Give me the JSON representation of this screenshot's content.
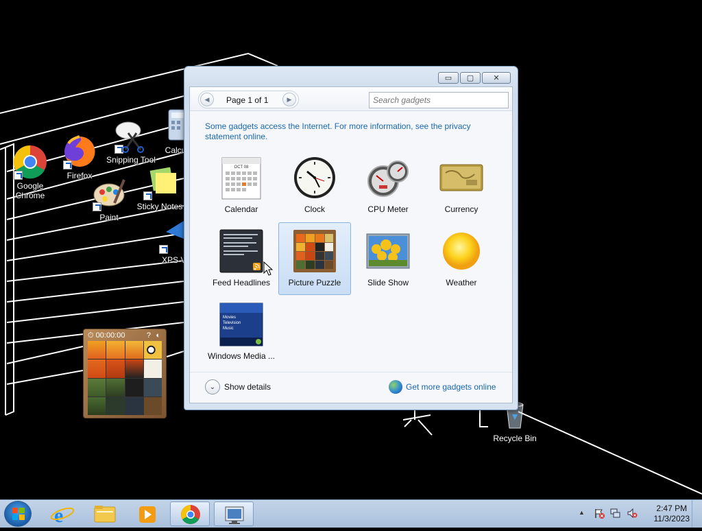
{
  "desktop": {
    "icons": [
      {
        "label": "Google Chrome"
      },
      {
        "label": "Firefox"
      },
      {
        "label": "Snipping Tool"
      },
      {
        "label": "Calcu"
      },
      {
        "label": "Paint"
      },
      {
        "label": "Sticky Notes"
      },
      {
        "label": "XPS Vi"
      },
      {
        "label": "Recycle Bin"
      }
    ],
    "puzzle_gadget": {
      "timer": "00:00:00",
      "help": "?"
    }
  },
  "gadget_window": {
    "window_buttons": {
      "minimize": "▭",
      "maximize": "▢",
      "close": "✕"
    },
    "pager": {
      "label": "Page 1 of 1",
      "prev": "◀",
      "next": "▶"
    },
    "search": {
      "placeholder": "Search gadgets"
    },
    "notice": "Some gadgets access the Internet.  For more information, see the privacy statement online.",
    "gadgets": [
      {
        "label": "Calendar",
        "selected": false
      },
      {
        "label": "Clock",
        "selected": false
      },
      {
        "label": "CPU Meter",
        "selected": false
      },
      {
        "label": "Currency",
        "selected": false
      },
      {
        "label": "Feed Headlines",
        "selected": false
      },
      {
        "label": "Picture Puzzle",
        "selected": true
      },
      {
        "label": "Slide Show",
        "selected": false
      },
      {
        "label": "Weather",
        "selected": false
      },
      {
        "label": "Windows Media ...",
        "selected": false
      }
    ],
    "calendar_month": "OCT 08",
    "media_menu": [
      "Movies",
      "Television",
      "Music"
    ],
    "footer": {
      "show_details": "Show details",
      "chevron": "⌄",
      "more_gadgets": "Get more gadgets online"
    }
  },
  "taskbar": {
    "clock_time": "2:47 PM",
    "clock_date": "11/3/2023",
    "tray_arrow": "▲"
  },
  "colors": {
    "accent_link": "#1a67b0",
    "selection": "#c9ddf5"
  }
}
